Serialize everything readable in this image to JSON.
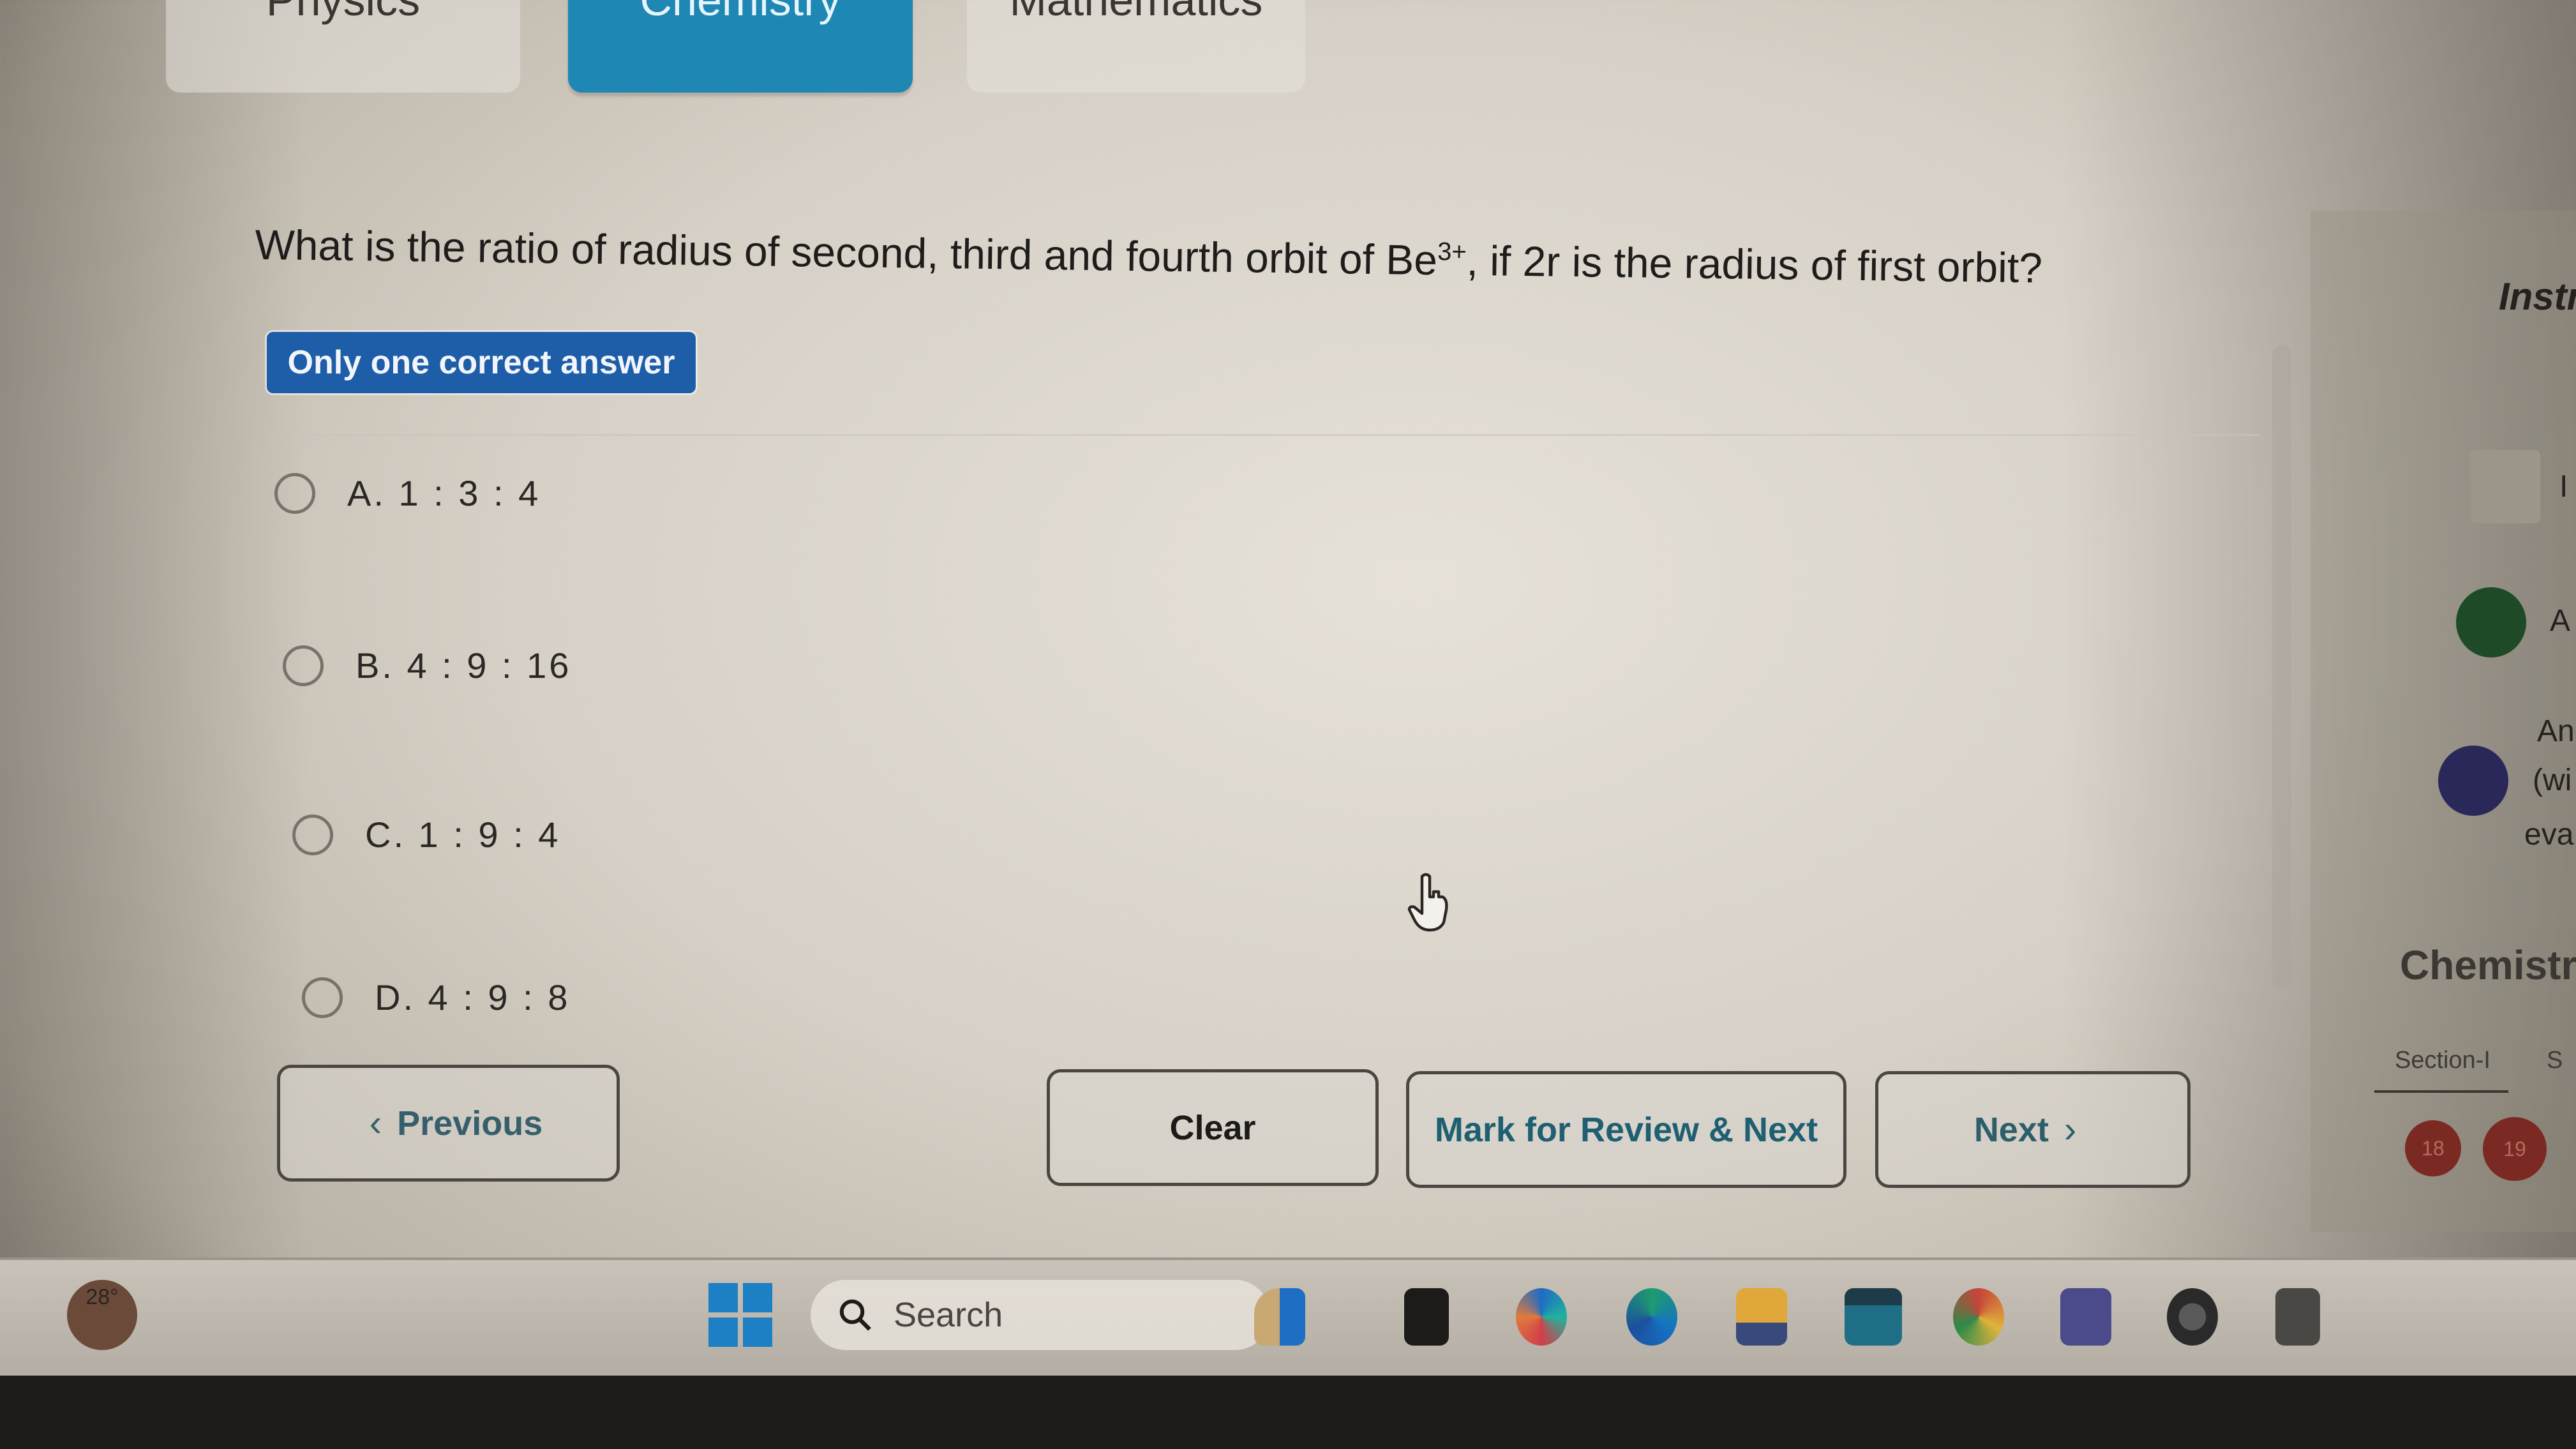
{
  "subject_tabs": [
    {
      "label": "Physics",
      "active": false
    },
    {
      "label": "Chemistry",
      "active": true
    },
    {
      "label": "Mathematics",
      "active": false
    }
  ],
  "question": {
    "text_before": "What is the ratio of radius of second, third and fourth orbit of Be",
    "superscript": "3+",
    "text_after": ", if 2r is the radius of first orbit?",
    "type_badge": "Only one correct answer"
  },
  "options": [
    {
      "label": "A. 1 : 3 : 4",
      "selected": false
    },
    {
      "label": "B. 4 : 9 : 16",
      "selected": false
    },
    {
      "label": "C. 1 : 9 : 4",
      "selected": false
    },
    {
      "label": "D. 4 : 9 : 8",
      "selected": false
    }
  ],
  "buttons": {
    "previous": "Previous",
    "clear": "Clear",
    "mark_review_next": "Mark for Review & Next",
    "next": "Next",
    "prev_chevron": "‹",
    "next_chevron": "›"
  },
  "right_panel": {
    "instructions_heading": "Instr",
    "legend_1_text": "I",
    "legend_2_text": "A",
    "legend_3_lines": [
      "An",
      "(wi",
      "eva"
    ],
    "subject_heading": "Chemistr",
    "section_tab": "Section-I",
    "section_tab_2": "S",
    "question_numbers": [
      "18",
      "19"
    ]
  },
  "taskbar": {
    "weather_temp": "28°",
    "search_placeholder": "Search",
    "apps": [
      "widgets",
      "file-explorer-dark",
      "copilot",
      "edge",
      "file-explorer",
      "mail",
      "chrome",
      "teams",
      "app-swirl",
      "calculator"
    ]
  }
}
